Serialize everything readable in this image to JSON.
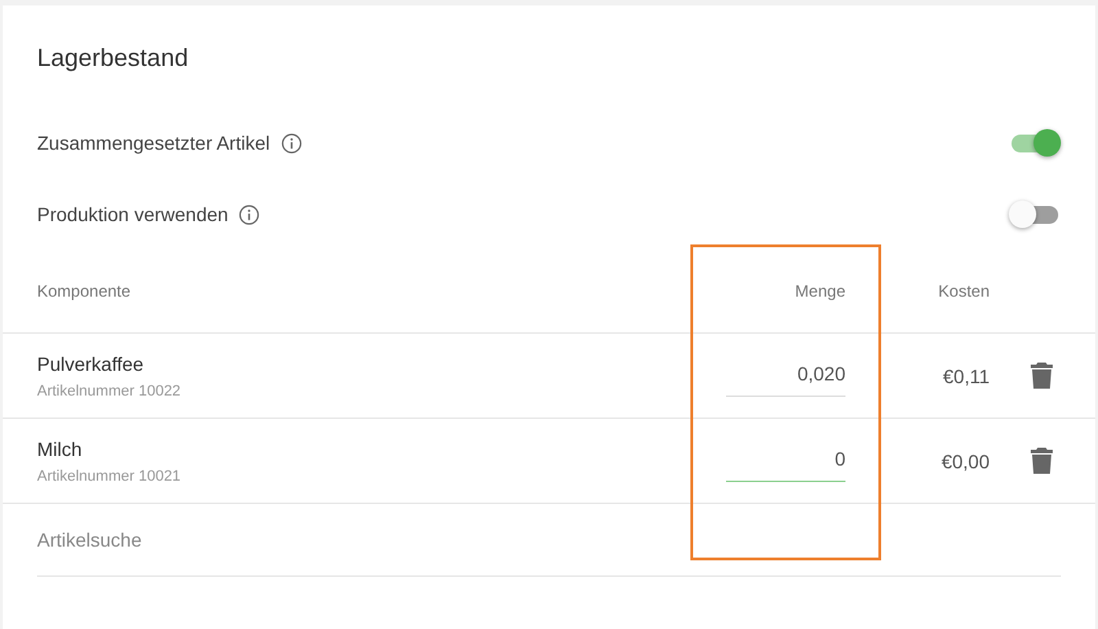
{
  "title": "Lagerbestand",
  "toggles": [
    {
      "label": "Zusammengesetzter Artikel",
      "on": true
    },
    {
      "label": "Produktion verwenden",
      "on": false
    }
  ],
  "columns": [
    "Komponente",
    "Menge",
    "Kosten"
  ],
  "rows": [
    {
      "name": "Pulverkaffee",
      "number": "Artikelnummer 10022",
      "quantity": "0,020",
      "focused": false,
      "cost": "€0,11"
    },
    {
      "name": "Milch",
      "number": "Artikelnummer 10021",
      "quantity": "0",
      "focused": true,
      "cost": "€0,00"
    }
  ],
  "search": {
    "placeholder": "Artikelsuche"
  }
}
